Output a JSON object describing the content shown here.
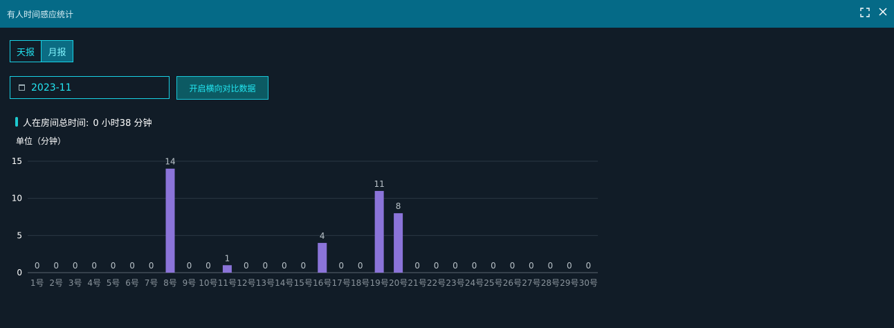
{
  "window": {
    "title": "有人时间感应统计",
    "maximize_icon": "fullscreen-icon",
    "close_icon": "close-icon"
  },
  "tabs": [
    {
      "label": "天报",
      "active": false
    },
    {
      "label": "月报",
      "active": true
    }
  ],
  "date_picker": {
    "icon": "calendar-icon",
    "value": "2023-11"
  },
  "compare_button": {
    "label": "开启横向对比数据"
  },
  "summary": {
    "label": "人在房间总时间:",
    "value": "0 小时38 分钟"
  },
  "unit_label": "单位（分钟）",
  "colors": {
    "accent": "#19d3e6",
    "bar": "#8b74d9",
    "titlebar": "#056a87"
  },
  "chart_data": {
    "type": "bar",
    "categories": [
      "1号",
      "2号",
      "3号",
      "4号",
      "5号",
      "6号",
      "7号",
      "8号",
      "9号",
      "10号",
      "11号",
      "12号",
      "13号",
      "14号",
      "15号",
      "16号",
      "17号",
      "18号",
      "19号",
      "20号",
      "21号",
      "22号",
      "23号",
      "24号",
      "25号",
      "26号",
      "27号",
      "28号",
      "29号",
      "30号"
    ],
    "values": [
      0,
      0,
      0,
      0,
      0,
      0,
      0,
      14,
      0,
      0,
      1,
      0,
      0,
      0,
      0,
      4,
      0,
      0,
      11,
      8,
      0,
      0,
      0,
      0,
      0,
      0,
      0,
      0,
      0,
      0
    ],
    "yticks": [
      0,
      5,
      10,
      15
    ],
    "ylim": [
      0,
      15
    ],
    "grid": true,
    "data_labels": true
  }
}
